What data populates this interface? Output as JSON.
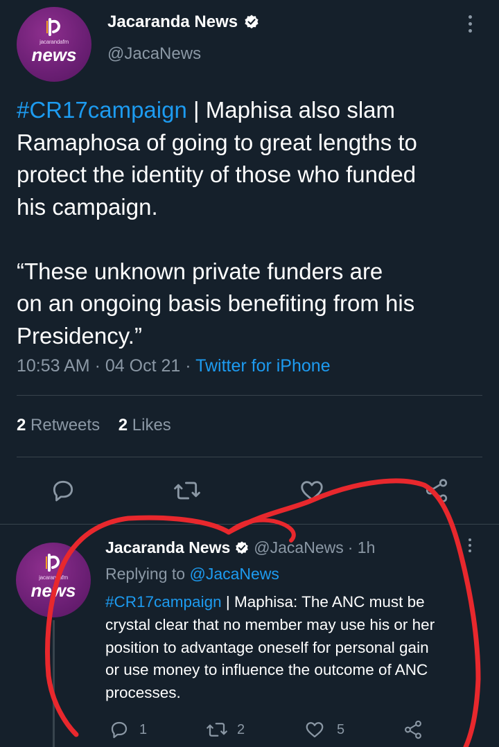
{
  "main_tweet": {
    "author_name": "Jacaranda News",
    "author_handle": "@JacaNews",
    "avatar_small_text": "jacarandafm",
    "avatar_big_text": "news",
    "hashtag": "#CR17campaign",
    "text_line1_rest": " | Maphisa also slam",
    "text_line2": "Ramaphosa of going to great lengths to",
    "text_line3": "protect the identity of those who funded",
    "text_line4": "his campaign.",
    "quote_line1": "“These unknown private funders are",
    "quote_line2": "on an ongoing basis benefiting from his",
    "quote_line3": "Presidency.”",
    "time": "10:53 AM",
    "dot1": "·",
    "date": "04 Oct 21",
    "dot2": "·",
    "source": "Twitter for iPhone",
    "retweets_count": "2",
    "retweets_label": "Retweets",
    "likes_count": "2",
    "likes_label": "Likes"
  },
  "reply_tweet": {
    "author_name": "Jacaranda News",
    "author_handle": "@JacaNews",
    "time_ago": "· 1h",
    "avatar_small_text": "jacarandafm",
    "avatar_big_text": "news",
    "replying_to_label": "Replying to",
    "replying_to_handle": "@JacaNews",
    "hashtag": "#CR17campaign",
    "line1_rest": " | Maphisa: The ANC must be",
    "line2": "crystal clear that no member may use his or her",
    "line3": "position to advantage oneself for personal gain",
    "line4": "or use money to influence the outcome of ANC",
    "line5": "processes.",
    "reply_count": "1",
    "retweet_count": "2",
    "like_count": "5"
  },
  "colors": {
    "background": "#15202b",
    "accent": "#1d9bf0",
    "muted": "#8b98a5",
    "annotation": "#e8282d"
  },
  "icons": [
    "verified-badge-icon",
    "more-icon",
    "reply-icon",
    "retweet-icon",
    "like-icon",
    "share-icon"
  ]
}
